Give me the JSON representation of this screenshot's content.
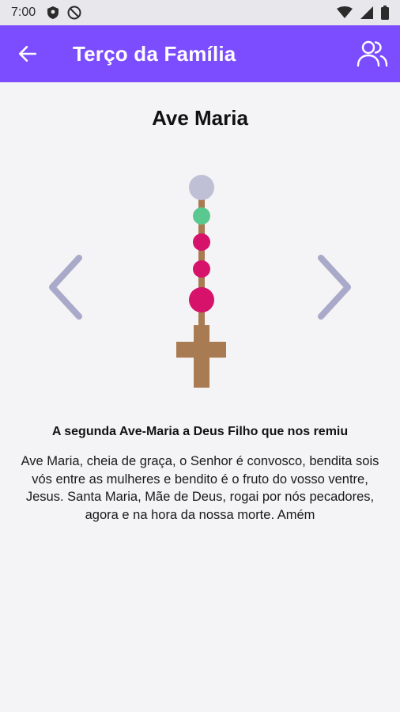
{
  "status_bar": {
    "time": "7:00",
    "icons_left": [
      "shield-icon",
      "do-not-disturb-icon"
    ],
    "icons_right": [
      "wifi-icon",
      "cell-signal-icon",
      "battery-icon"
    ]
  },
  "app_bar": {
    "title": "Terço da Família",
    "back_icon": "arrow-back-icon",
    "action_icon": "people-icon",
    "color": "#7b4dff"
  },
  "prayer": {
    "title": "Ave Maria",
    "subtitle": "A segunda Ave-Maria a Deus Filho que nos remiu",
    "text": "Ave Maria, cheia de graça, o Senhor é convosco, bendita sois vós entre as mulheres e bendito é o fruto do vosso ventre, Jesus. Santa Maria, Mãe de Deus, rogai por nós pecadores, agora e na hora da nossa morte. Amém"
  },
  "rosary": {
    "bead_colors": {
      "pending": "#bfbfd6",
      "current": "#5ac98f",
      "done": "#d6126a",
      "cross": "#a97b52",
      "string": "#a97b52"
    },
    "beads_top_to_bottom": [
      "pending",
      "current",
      "done",
      "done",
      "done-large"
    ]
  },
  "navigation": {
    "previous_icon": "chevron-left-icon",
    "next_icon": "chevron-right-icon",
    "arrow_color": "#a9a9c9"
  }
}
